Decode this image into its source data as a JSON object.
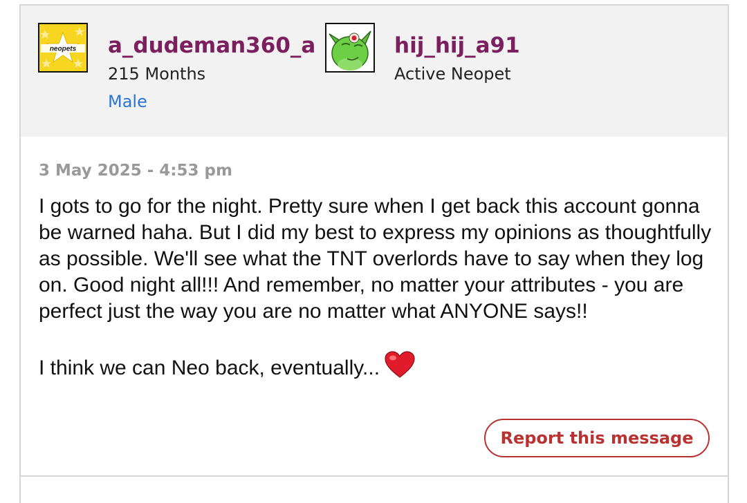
{
  "sender": {
    "username": "a_dudeman360_a",
    "account_age": "215 Months",
    "gender": "Male",
    "avatar_icon": "neopets-star-avatar-icon",
    "avatar_text": "neopets"
  },
  "pet": {
    "name": "hij_hij_a91",
    "status": "Active Neopet",
    "avatar_icon": "green-pet-avatar-icon"
  },
  "message": {
    "timestamp": "3 May 2025 - 4:53 pm",
    "text": "I gots to go for the night. Pretty sure when I get back this account gonna be warned haha. But I did my best to express my opinions as thoughtfully as possible. We'll see what the TNT overlords have to say when they log on. Good night all!!! And remember, no matter your attributes - you are perfect just the way you are no matter what ANYONE says!!\n\nI think we can Neo back, eventually...",
    "emoji_icon": "red-heart-icon"
  },
  "actions": {
    "report_label": "Report this message"
  },
  "colors": {
    "username": "#7b1f5e",
    "gender_link": "#2a74d6",
    "report": "#b83232",
    "header_bg": "#f2f2f2"
  }
}
